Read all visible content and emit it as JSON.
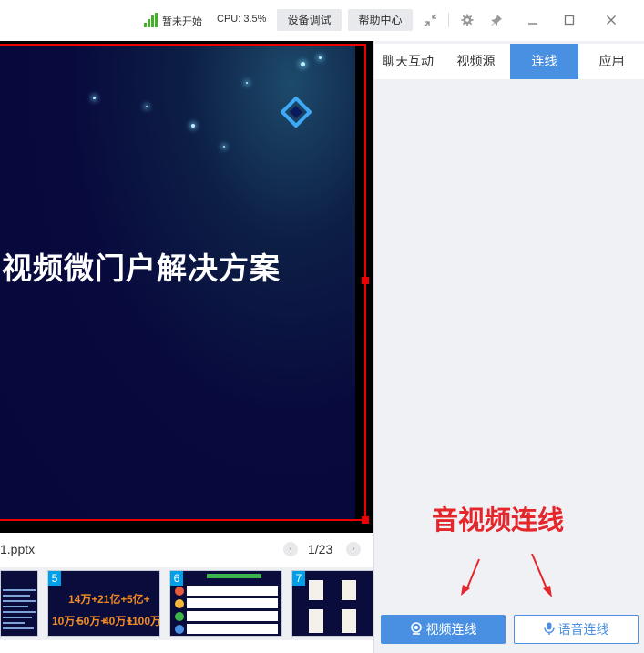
{
  "topbar": {
    "status": "暂未开始",
    "cpu": "CPU: 3.5%",
    "device_debug": "设备调试",
    "help_center": "帮助中心"
  },
  "slide": {
    "title": "视频微门户解决方案"
  },
  "file": {
    "name": "1.pptx",
    "page": "1/23"
  },
  "thumbnails": [
    {
      "num": ""
    },
    {
      "num": "5",
      "metrics": [
        "14万+",
        "21亿+",
        "5亿+",
        "10万+",
        "50万+",
        "40万+",
        "1100万"
      ]
    },
    {
      "num": "6"
    },
    {
      "num": "7"
    }
  ],
  "panel": {
    "tabs": [
      "聊天互动",
      "视频源",
      "连线",
      "应用"
    ],
    "active_tab": "连线",
    "annotation": "音视频连线",
    "video_call": "视频连线",
    "voice_call": "语音连线"
  },
  "colors": {
    "accent": "#4a90e2",
    "annotation": "#e5262a",
    "signal": "#43b02a"
  }
}
